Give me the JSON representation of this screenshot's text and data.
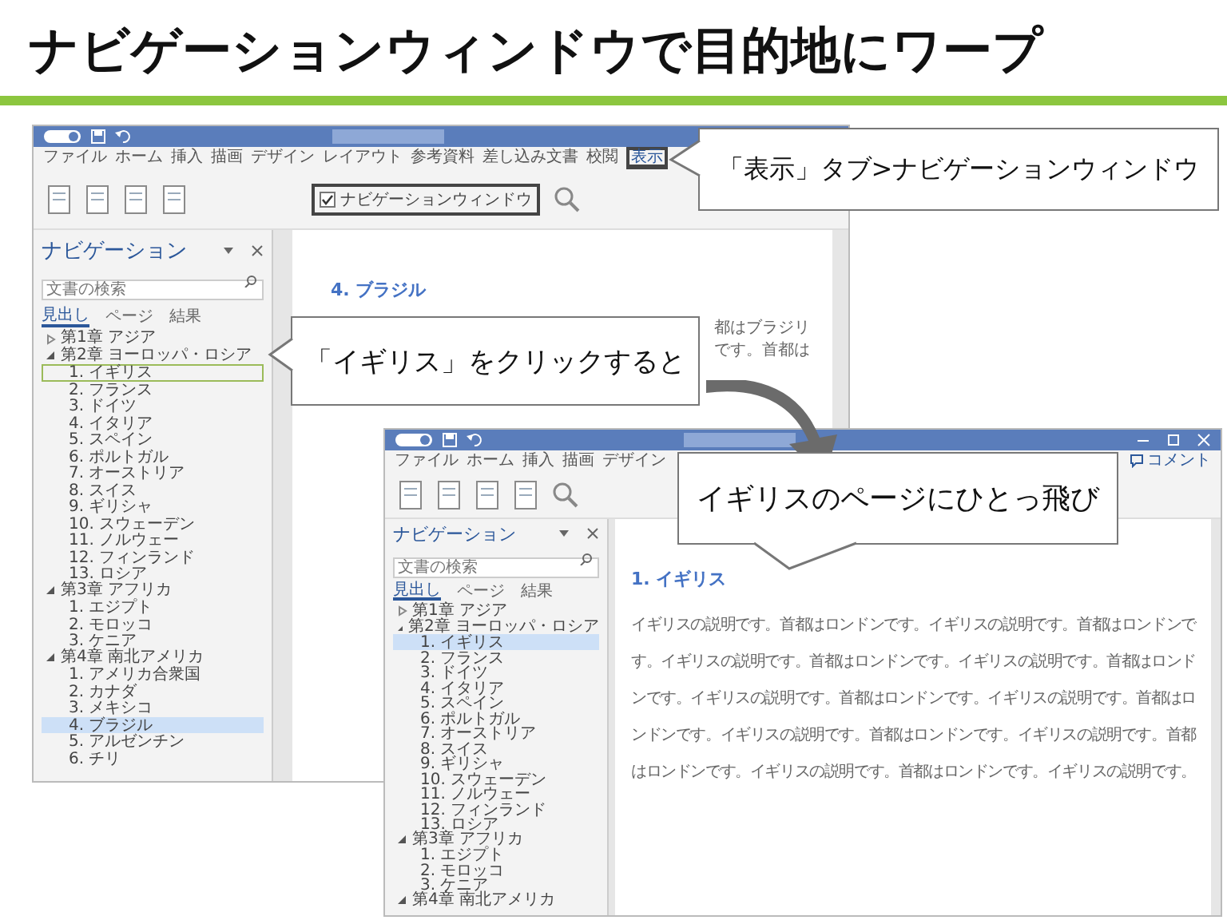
{
  "title": "ナビゲーションウィンドウで目的地にワープ",
  "windows": [
    {
      "tabs": [
        {
          "label": "ファイル",
          "selected": false
        },
        {
          "label": "ホーム",
          "selected": false
        },
        {
          "label": "挿入",
          "selected": false
        },
        {
          "label": "描画",
          "selected": false
        },
        {
          "label": "デザイン",
          "selected": false
        },
        {
          "label": "レイアウト",
          "selected": false
        },
        {
          "label": "参考資料",
          "selected": false
        },
        {
          "label": "差し込み文書",
          "selected": false
        },
        {
          "label": "校閲",
          "selected": false
        },
        {
          "label": "表示",
          "selected": true
        }
      ],
      "ribbon_checkbox": {
        "label": "ナビゲーションウィンドウ",
        "checked": true
      },
      "nav": {
        "title": "ナビゲーション",
        "search_placeholder": "文書の検索",
        "tabs": [
          {
            "label": "見出し",
            "selected": true
          },
          {
            "label": "ページ",
            "selected": false
          },
          {
            "label": "結果",
            "selected": false
          }
        ],
        "tree": [
          {
            "label": "第1章 アジア",
            "expanded": false
          },
          {
            "label": "第2章 ヨーロッパ・ロシア",
            "expanded": true,
            "children": [
              {
                "label": "1. イギリス",
                "selected": false,
                "hovered": true
              },
              {
                "label": "2. フランス",
                "selected": false,
                "hovered": false
              },
              {
                "label": "3. ドイツ",
                "selected": false,
                "hovered": false
              },
              {
                "label": "4. イタリア",
                "selected": false,
                "hovered": false
              },
              {
                "label": "5. スペイン",
                "selected": false,
                "hovered": false
              },
              {
                "label": "6. ポルトガル",
                "selected": false,
                "hovered": false
              },
              {
                "label": "7. オーストリア",
                "selected": false,
                "hovered": false
              },
              {
                "label": "8. スイス",
                "selected": false,
                "hovered": false
              },
              {
                "label": "9. ギリシャ",
                "selected": false,
                "hovered": false
              },
              {
                "label": "10. スウェーデン",
                "selected": false,
                "hovered": false
              },
              {
                "label": "11. ノルウェー",
                "selected": false,
                "hovered": false
              },
              {
                "label": "12. フィンランド",
                "selected": false,
                "hovered": false
              },
              {
                "label": "13. ロシア",
                "selected": false,
                "hovered": false
              }
            ]
          },
          {
            "label": "第3章 アフリカ",
            "expanded": true,
            "children": [
              {
                "label": "1. エジプト",
                "selected": false,
                "hovered": false
              },
              {
                "label": "2. モロッコ",
                "selected": false,
                "hovered": false
              },
              {
                "label": "3. ケニア",
                "selected": false,
                "hovered": false
              }
            ]
          },
          {
            "label": "第4章 南北アメリカ",
            "expanded": true,
            "children": [
              {
                "label": "1. アメリカ合衆国",
                "selected": false,
                "hovered": false
              },
              {
                "label": "2. カナダ",
                "selected": false,
                "hovered": false
              },
              {
                "label": "3. メキシコ",
                "selected": false,
                "hovered": false
              },
              {
                "label": "4. ブラジル",
                "selected": true,
                "hovered": false
              },
              {
                "label": "5. アルゼンチン",
                "selected": false,
                "hovered": false
              },
              {
                "label": "6. チリ",
                "selected": false,
                "hovered": false
              }
            ]
          }
        ]
      },
      "document": {
        "heading": "4. ブラジル",
        "lines": [
          "都はブラジリ",
          "です。首都は"
        ]
      }
    },
    {
      "tabs": [
        {
          "label": "ファイル",
          "selected": false
        },
        {
          "label": "ホーム",
          "selected": false
        },
        {
          "label": "挿入",
          "selected": false
        },
        {
          "label": "描画",
          "selected": false
        },
        {
          "label": "デザイン",
          "selected": false
        }
      ],
      "comment_button": "コメント",
      "nav": {
        "title": "ナビゲーション",
        "search_placeholder": "文書の検索",
        "tabs": [
          {
            "label": "見出し",
            "selected": true
          },
          {
            "label": "ページ",
            "selected": false
          },
          {
            "label": "結果",
            "selected": false
          }
        ],
        "tree": [
          {
            "label": "第1章 アジア",
            "expanded": false
          },
          {
            "label": "第2章 ヨーロッパ・ロシア",
            "expanded": true,
            "children": [
              {
                "label": "1. イギリス",
                "selected": true
              },
              {
                "label": "2. フランス",
                "selected": false
              },
              {
                "label": "3. ドイツ",
                "selected": false
              },
              {
                "label": "4. イタリア",
                "selected": false
              },
              {
                "label": "5. スペイン",
                "selected": false
              },
              {
                "label": "6. ポルトガル",
                "selected": false
              },
              {
                "label": "7. オーストリア",
                "selected": false
              },
              {
                "label": "8. スイス",
                "selected": false
              },
              {
                "label": "9. ギリシャ",
                "selected": false
              },
              {
                "label": "10. スウェーデン",
                "selected": false
              },
              {
                "label": "11. ノルウェー",
                "selected": false
              },
              {
                "label": "12. フィンランド",
                "selected": false
              },
              {
                "label": "13. ロシア",
                "selected": false
              }
            ]
          },
          {
            "label": "第3章 アフリカ",
            "expanded": true,
            "children": [
              {
                "label": "1. エジプト",
                "selected": false
              },
              {
                "label": "2. モロッコ",
                "selected": false
              },
              {
                "label": "3. ケニア",
                "selected": false
              }
            ]
          },
          {
            "label": "第4章 南北アメリカ",
            "expanded": true
          }
        ]
      },
      "document": {
        "heading": "1. イギリス",
        "lines": [
          "イギリスの説明です。首都はロンドンです。イギリスの説明です。首都はロンドンで",
          "す。イギリスの説明です。首都はロンドンです。イギリスの説明です。首都はロンド",
          "ンです。イギリスの説明です。首都はロンドンです。イギリスの説明です。首都はロ",
          "ンドンです。イギリスの説明です。首都はロンドンです。イギリスの説明です。首都",
          "はロンドンです。イギリスの説明です。首都はロンドンです。イギリスの説明です。"
        ]
      }
    }
  ],
  "callouts": [
    {
      "text": "「表示」タブ>ナビゲーションウィンドウ"
    },
    {
      "text": "「イギリス」をクリックすると"
    },
    {
      "text": "イギリスのページにひとっ飛び"
    }
  ]
}
